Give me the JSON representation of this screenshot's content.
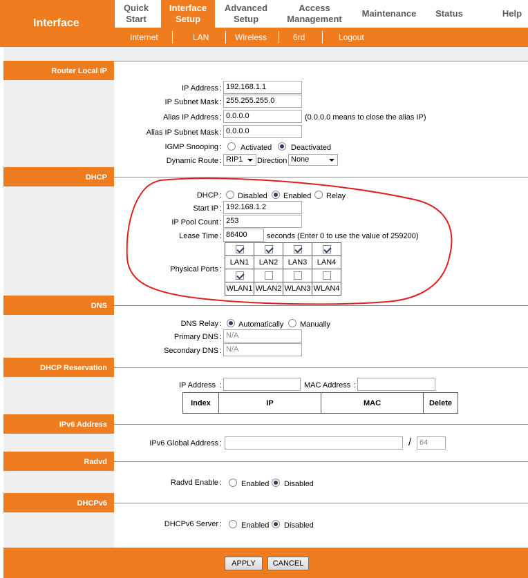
{
  "brand": "Interface",
  "nav": {
    "quick_start": [
      "Quick",
      "Start"
    ],
    "interface_setup": [
      "Interface",
      "Setup"
    ],
    "advanced_setup": [
      "Advanced",
      "Setup"
    ],
    "access_management": [
      "Access",
      "Management"
    ],
    "maintenance": "Maintenance",
    "status": "Status",
    "help": "Help"
  },
  "subnav": [
    "Internet",
    "LAN",
    "Wireless",
    "6rd",
    "Logout"
  ],
  "router_local_ip": {
    "title": "Router Local IP",
    "ip_address_label": "IP Address",
    "ip_address": "192.168.1.1",
    "subnet_label": "IP Subnet Mask",
    "subnet": "255.255.255.0",
    "alias_ip_label": "Alias IP Address",
    "alias_ip": "0.0.0.0",
    "alias_note": "(0.0.0.0 means to close the alias IP)",
    "alias_subnet_label": "Alias IP Subnet Mask",
    "alias_subnet": "0.0.0.0",
    "igmp_label": "IGMP Snooping",
    "igmp_options": [
      "Activated",
      "Deactivated"
    ],
    "dynamic_route_label": "Dynamic Route",
    "dynamic_route": "RIP1",
    "direction_label": "Direction",
    "direction": "None"
  },
  "dhcp": {
    "title": "DHCP",
    "dhcp_label": "DHCP",
    "dhcp_options": [
      "Disabled",
      "Enabled",
      "Relay"
    ],
    "start_ip_label": "Start IP",
    "start_ip": "192.168.1.2",
    "pool_label": "IP Pool Count",
    "pool": "253",
    "lease_label": "Lease Time",
    "lease": "86400",
    "lease_note": "seconds (Enter 0 to use the value of 259200)",
    "ports_label": "Physical Ports",
    "lan_ports": [
      "LAN1",
      "LAN2",
      "LAN3",
      "LAN4"
    ],
    "wlan_ports": [
      "WLAN1",
      "WLAN2",
      "WLAN3",
      "WLAN4"
    ]
  },
  "dns": {
    "title": "DNS",
    "relay_label": "DNS Relay",
    "relay_options": [
      "Automatically",
      "Manually"
    ],
    "primary_label": "Primary DNS",
    "primary_placeholder": "N/A",
    "secondary_label": "Secondary DNS",
    "secondary_placeholder": "N/A"
  },
  "reservation": {
    "title": "DHCP Reservation",
    "ip_label": "IP Address",
    "mac_label": "MAC Address",
    "columns": [
      "Index",
      "IP",
      "MAC",
      "Delete"
    ]
  },
  "ipv6": {
    "title": "IPv6 Address",
    "global_label": "IPv6 Global Address",
    "slash": "/",
    "prefix_placeholder": "64"
  },
  "radvd": {
    "title": "Radvd",
    "enable_label": "Radvd Enable",
    "options": [
      "Enabled",
      "Disabled"
    ]
  },
  "dhcpv6": {
    "title": "DHCPv6",
    "server_label": "DHCPv6 Server",
    "options": [
      "Enabled",
      "Disabled"
    ]
  },
  "buttons": {
    "apply": "APPLY",
    "cancel": "CANCEL"
  },
  "colors": {
    "accent": "#ef7d1f",
    "annotation": "#e0201e"
  }
}
